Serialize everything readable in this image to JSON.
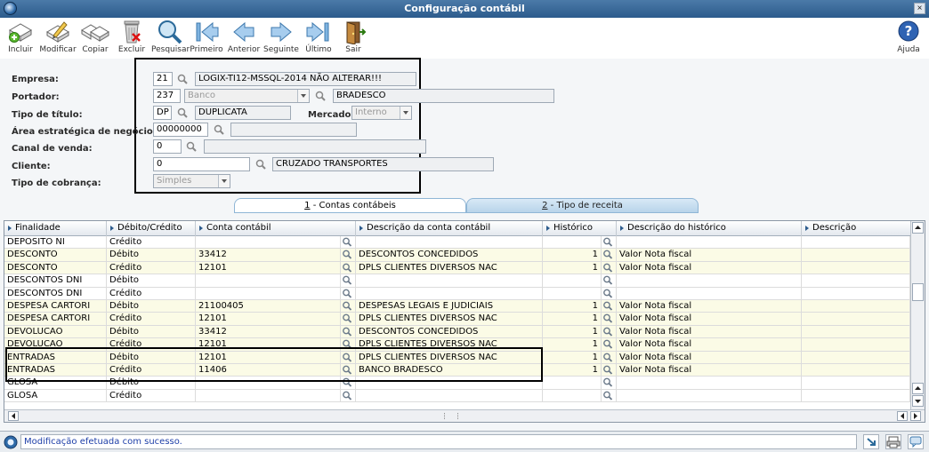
{
  "window": {
    "title": "Configuração contábil",
    "close_glyph": "×"
  },
  "toolbar": [
    {
      "id": "incluir",
      "label": "Incluir",
      "icon": "add-icon"
    },
    {
      "id": "modificar",
      "label": "Modificar",
      "icon": "edit-icon"
    },
    {
      "id": "copiar",
      "label": "Copiar",
      "icon": "copy-icon"
    },
    {
      "id": "excluir",
      "label": "Excluir",
      "icon": "trash-icon"
    },
    {
      "id": "pesquisar",
      "label": "Pesquisar",
      "icon": "search-icon"
    },
    {
      "id": "primeiro",
      "label": "Primeiro",
      "icon": "first-icon"
    },
    {
      "id": "anterior",
      "label": "Anterior",
      "icon": "previous-icon"
    },
    {
      "id": "seguinte",
      "label": "Seguinte",
      "icon": "next-icon"
    },
    {
      "id": "ultimo",
      "label": "Último",
      "icon": "last-icon"
    },
    {
      "id": "sair",
      "label": "Sair",
      "icon": "exit-door-icon"
    },
    {
      "id": "ajuda",
      "label": "Ajuda",
      "icon": "help-icon"
    }
  ],
  "form": {
    "empresa": {
      "label": "Empresa:",
      "code": "21",
      "desc": "LOGIX-TI12-MSSQL-2014 NÃO ALTERAR!!!"
    },
    "portador": {
      "label": "Portador:",
      "code": "237",
      "type": "Banco",
      "desc": "BRADESCO"
    },
    "tipo_titulo": {
      "label": "Tipo de título:",
      "code": "DP",
      "desc": "DUPLICATA"
    },
    "mercado": {
      "label": "Mercado:",
      "value": "Interno"
    },
    "area": {
      "label": "Área estratégica de negócio:",
      "code": "00000000",
      "desc": ""
    },
    "canal": {
      "label": "Canal de venda:",
      "code": "0",
      "desc": ""
    },
    "cliente": {
      "label": "Cliente:",
      "code": "0",
      "desc": "CRUZADO TRANSPORTES"
    },
    "cobranca": {
      "label": "Tipo de cobrança:",
      "value": "Simples"
    }
  },
  "tabs": [
    {
      "key": "1",
      "label": " - Contas contábeis",
      "active": true
    },
    {
      "key": "2",
      "label": " - Tipo de receita",
      "active": false
    }
  ],
  "grid": {
    "columns": [
      "Finalidade",
      "Débito/Crédito",
      "Conta contábil",
      "Descrição da conta contábil",
      "Histórico",
      "Descrição do histórico",
      "Descrição"
    ],
    "rows": [
      {
        "finalidade": "DEPOSITO NI",
        "dc": "Crédito",
        "conta": "",
        "desc_conta": "",
        "hist": "",
        "desc_hist": "",
        "desc": ""
      },
      {
        "finalidade": "DESCONTO",
        "dc": "Débito",
        "conta": "33412",
        "desc_conta": "DESCONTOS CONCEDIDOS",
        "hist": "1",
        "desc_hist": "Valor Nota fiscal",
        "desc": ""
      },
      {
        "finalidade": "DESCONTO",
        "dc": "Crédito",
        "conta": "12101",
        "desc_conta": "DPLS CLIENTES DIVERSOS NAC",
        "hist": "1",
        "desc_hist": "Valor Nota fiscal",
        "desc": ""
      },
      {
        "finalidade": "DESCONTOS DNI",
        "dc": "Débito",
        "conta": "",
        "desc_conta": "",
        "hist": "",
        "desc_hist": "",
        "desc": ""
      },
      {
        "finalidade": "DESCONTOS DNI",
        "dc": "Crédito",
        "conta": "",
        "desc_conta": "",
        "hist": "",
        "desc_hist": "",
        "desc": ""
      },
      {
        "finalidade": "DESPESA CARTORI",
        "dc": "Débito",
        "conta": "21100405",
        "desc_conta": "DESPESAS LEGAIS E JUDICIAIS",
        "hist": "1",
        "desc_hist": "Valor Nota fiscal",
        "desc": ""
      },
      {
        "finalidade": "DESPESA CARTORI",
        "dc": "Crédito",
        "conta": "12101",
        "desc_conta": "DPLS CLIENTES DIVERSOS NAC",
        "hist": "1",
        "desc_hist": "Valor Nota fiscal",
        "desc": ""
      },
      {
        "finalidade": "DEVOLUCAO",
        "dc": "Débito",
        "conta": "33412",
        "desc_conta": "DESCONTOS CONCEDIDOS",
        "hist": "1",
        "desc_hist": "Valor Nota fiscal",
        "desc": ""
      },
      {
        "finalidade": "DEVOLUCAO",
        "dc": "Crédito",
        "conta": "12101",
        "desc_conta": "DPLS CLIENTES DIVERSOS NAC",
        "hist": "1",
        "desc_hist": "Valor Nota fiscal",
        "desc": ""
      },
      {
        "finalidade": "ENTRADAS",
        "dc": "Débito",
        "conta": "12101",
        "desc_conta": "DPLS CLIENTES DIVERSOS NAC",
        "hist": "1",
        "desc_hist": "Valor Nota fiscal",
        "desc": ""
      },
      {
        "finalidade": "ENTRADAS",
        "dc": "Crédito",
        "conta": "11406",
        "desc_conta": "BANCO BRADESCO",
        "hist": "1",
        "desc_hist": "Valor Nota fiscal",
        "desc": ""
      },
      {
        "finalidade": "GLOSA",
        "dc": "Débito",
        "conta": "",
        "desc_conta": "",
        "hist": "",
        "desc_hist": "",
        "desc": ""
      },
      {
        "finalidade": "GLOSA",
        "dc": "Crédito",
        "conta": "",
        "desc_conta": "",
        "hist": "",
        "desc_hist": "",
        "desc": ""
      }
    ]
  },
  "status": {
    "message": "Modificação efetuada com sucesso."
  },
  "colors": {
    "titlebar": "#2c5b8c",
    "status_text": "#1e3fa8",
    "row_alt": "#fbfbe6"
  }
}
